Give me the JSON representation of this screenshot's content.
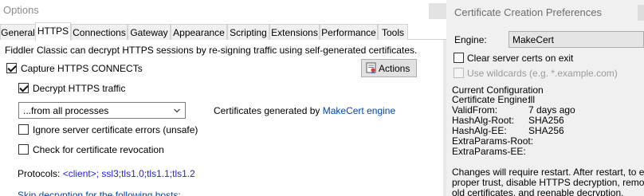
{
  "options": {
    "title": "Options",
    "tabs": [
      "General",
      "HTTPS",
      "Connections",
      "Gateway",
      "Appearance",
      "Scripting",
      "Extensions",
      "Performance",
      "Tools"
    ],
    "active_tab": "HTTPS",
    "intro": "Fiddler Classic can decrypt HTTPS sessions by re-signing traffic using self-generated certificates.",
    "capture_label": "Capture HTTPS CONNECTs",
    "capture_checked": true,
    "actions_label": "Actions",
    "decrypt_label": "Decrypt HTTPS traffic",
    "decrypt_checked": true,
    "process_select": "...from all processes",
    "certs_generated_prefix": "Certificates generated by",
    "certs_generated_link": "MakeCert engine",
    "ignore_errors_label": "Ignore server certificate errors (unsafe)",
    "ignore_errors_checked": false,
    "revocation_label": "Check for certificate revocation",
    "revocation_checked": false,
    "protocols_label": "Protocols:",
    "protocols_value": "<client>; ssl3;tls1.0;tls1.1;tls1.2",
    "skip_label": "Skip decryption for the following hosts:"
  },
  "ccp": {
    "title": "Certificate Creation Preferences",
    "engine_label": "Engine:",
    "engine_value": "MakeCert",
    "clear_certs_label": "Clear server certs on exit",
    "clear_certs_checked": false,
    "wildcards_label": "Use wildcards (e.g. *.example.com)",
    "wildcards_checked": false,
    "wildcards_enabled": false,
    "config_heading": "Current Configuration",
    "config": [
      {
        "key": "Certificate Engine:",
        "value": "lll"
      },
      {
        "key": "ValidFrom:",
        "value": "7 days ago"
      },
      {
        "key": "HashAlg-Root:",
        "value": "SHA256"
      },
      {
        "key": "HashAlg-EE:",
        "value": "SHA256"
      },
      {
        "key": "ExtraParams-Root:",
        "value": ""
      },
      {
        "key": "ExtraParams-EE:",
        "value": ""
      }
    ],
    "restart_note": [
      "Changes will require restart. After restart, to ensure",
      "proper trust, disable HTTPS decryption, remove",
      "old certificates, and reenable decryption."
    ]
  },
  "colors": {
    "link": "#0645ad",
    "protocols": "#2323d4",
    "disabled_text": "#9a9a9a"
  },
  "icons": {
    "actions": "certificate-icon",
    "dropdown": "chevron-down-icon"
  }
}
